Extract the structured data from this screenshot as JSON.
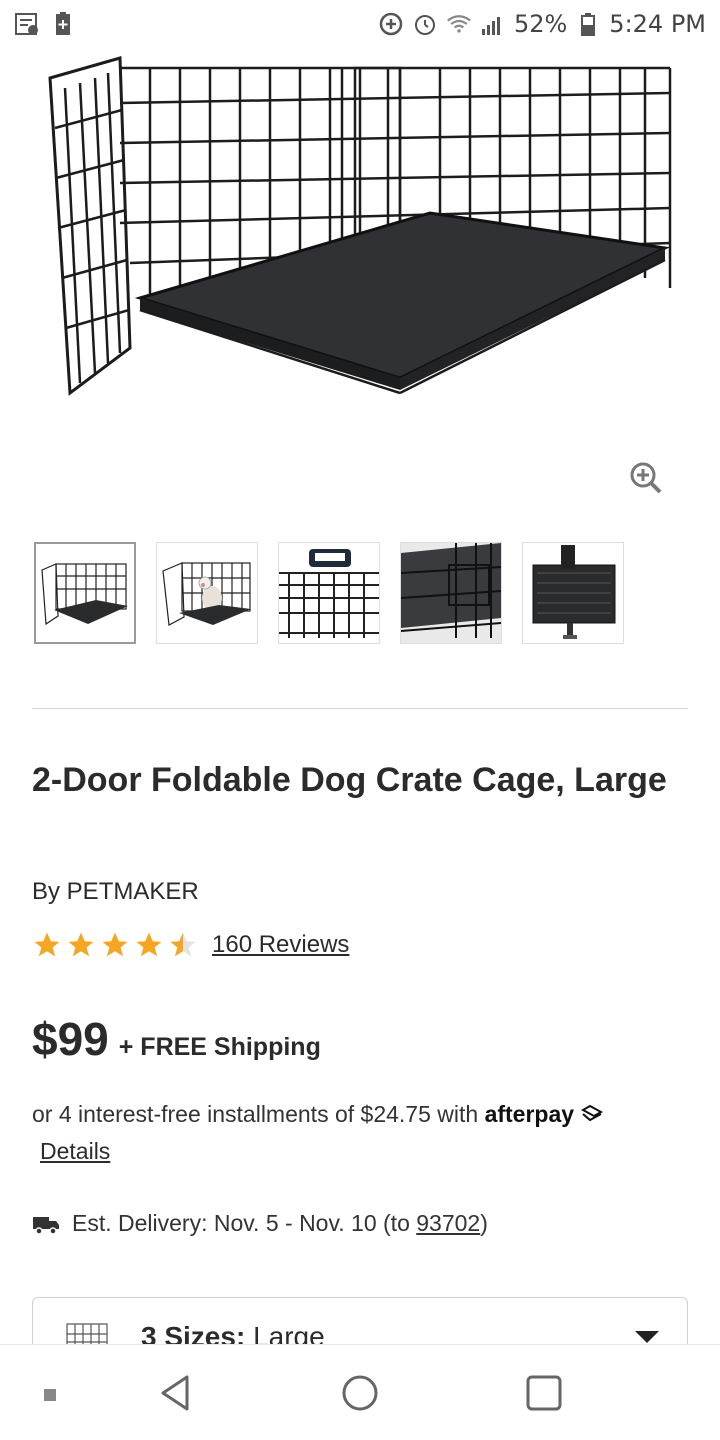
{
  "status_bar": {
    "battery": "52%",
    "time": "5:24 PM",
    "icons": [
      "notification-icon",
      "battery-saver-icon",
      "data-saver-icon",
      "alarm-icon",
      "wifi-icon",
      "signal-icon",
      "battery-icon"
    ]
  },
  "product": {
    "title": "2-Door Foldable Dog Crate Cage, Large",
    "brand": "By PETMAKER",
    "rating": 4.5,
    "reviews": "160 Reviews",
    "price": "$99",
    "shipping": "+ FREE Shipping",
    "afterpay_text": "or 4 interest-free installments of $24.75 with",
    "afterpay_brand": "afterpay",
    "details_link": "Details",
    "delivery_prefix": "Est. Delivery: Nov. 5 - Nov. 10 (to ",
    "delivery_zip": "93702",
    "delivery_suffix": ")",
    "size_count": "3 Sizes:",
    "size_value": "Large"
  },
  "colors": {
    "star": "#f5a623",
    "text": "#2b2b2b"
  }
}
